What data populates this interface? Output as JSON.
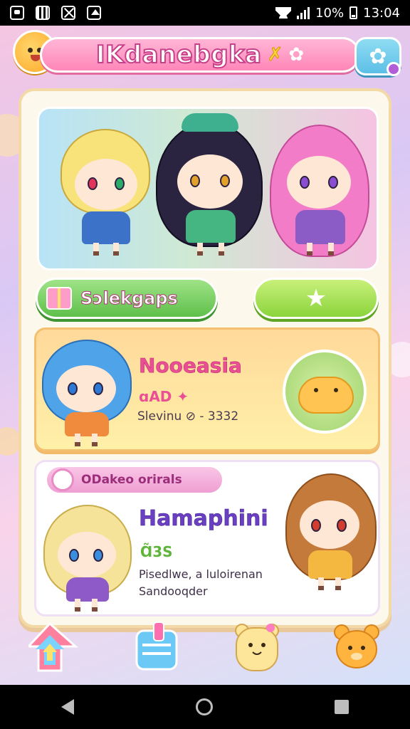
{
  "status_bar": {
    "battery": "10%",
    "time": "13:04"
  },
  "header": {
    "title": "IKdanebgka",
    "title_sparkle": "✗",
    "title_star": "✿"
  },
  "actions": {
    "left_button_label": "Sɔlekgaps",
    "right_button_icon": "star-icon"
  },
  "card_1": {
    "name": "Nooeasia",
    "stat": "ɑAD ✦",
    "line": "Slevinu ⊘ - 3332"
  },
  "card_2": {
    "tag": "ODakeo orirals",
    "name": "Hamaphini",
    "stat": "Ɑ̃3S",
    "line_1": "Pisedlwe, a luloirenan",
    "line_2": "Sandooqder"
  },
  "colors": {
    "header_pink": "#ff86b8",
    "accent_green": "#5fc04a",
    "card_gold": "#ffd99a",
    "name_pink": "#ea4f95",
    "name_purple": "#6b3fc2"
  },
  "icons": {
    "top_left_mascot": "sun-mascot-icon",
    "top_right_settings": "gallery-settings-icon",
    "bottom": [
      "rainbow-arrow-icon",
      "bag-icon",
      "teddy-icon",
      "orange-bear-icon"
    ]
  }
}
